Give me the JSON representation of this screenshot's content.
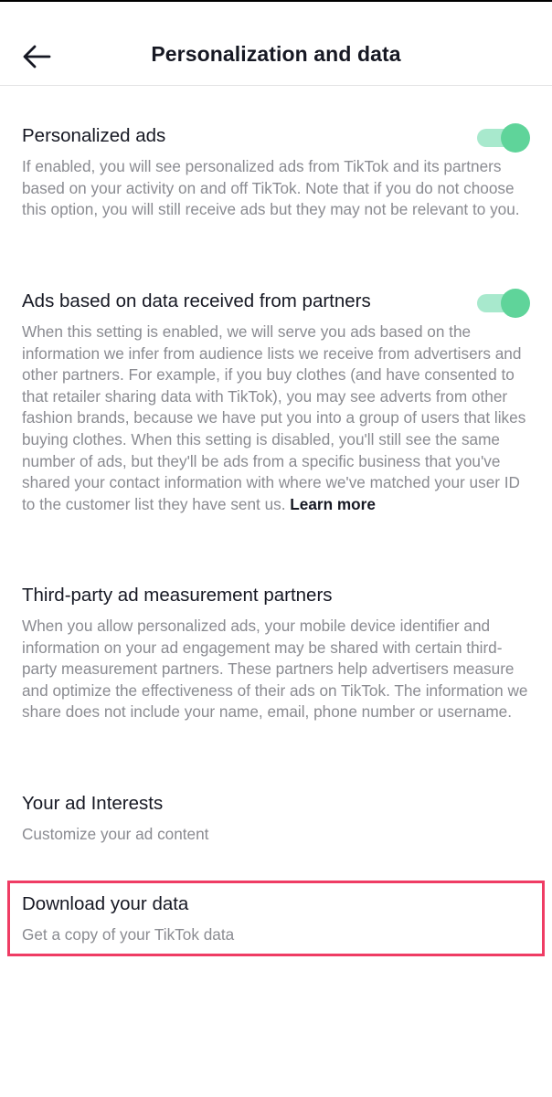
{
  "header": {
    "title": "Personalization and data",
    "back_icon": "arrow-left-icon"
  },
  "sections": {
    "personalized_ads": {
      "title": "Personalized ads",
      "description": "If enabled, you will see personalized ads from TikTok and its partners based on your activity on and off TikTok.  Note that if you do not choose this option, you will still receive ads but they may not be relevant to you.",
      "toggle_on": true
    },
    "partner_ads": {
      "title": "Ads based on data received from partners",
      "description": "When this setting is enabled, we will serve you ads based on the information we infer from audience lists we receive from advertisers and other partners. For example, if you buy clothes (and have consented to that retailer sharing data with TikTok), you may see adverts from other fashion brands, because we have put you into a group of users that likes buying clothes. When this setting is disabled, you'll still see the same number of ads, but they'll be ads from a specific business that you've shared your contact information with where we've matched your user ID to the customer list they have sent us.",
      "learn_more": "Learn more",
      "toggle_on": true
    },
    "third_party": {
      "title": "Third-party ad measurement partners",
      "description": "When you allow personalized ads, your mobile device identifier and information on your ad engagement may be shared with certain third-party measurement partners. These partners help advertisers measure and optimize the effectiveness of their ads on TikTok. The information we share does not include your name, email, phone number or username."
    },
    "ad_interests": {
      "title": "Your ad Interests",
      "description": "Customize your ad content"
    },
    "download_data": {
      "title": "Download your data",
      "description": "Get a copy of your TikTok data"
    }
  },
  "colors": {
    "toggle_track": "#a8e9cd",
    "toggle_knob": "#5fd49a",
    "highlight": "#ef3c64",
    "secondary_text": "#8a8b91",
    "primary_text": "#161823"
  }
}
